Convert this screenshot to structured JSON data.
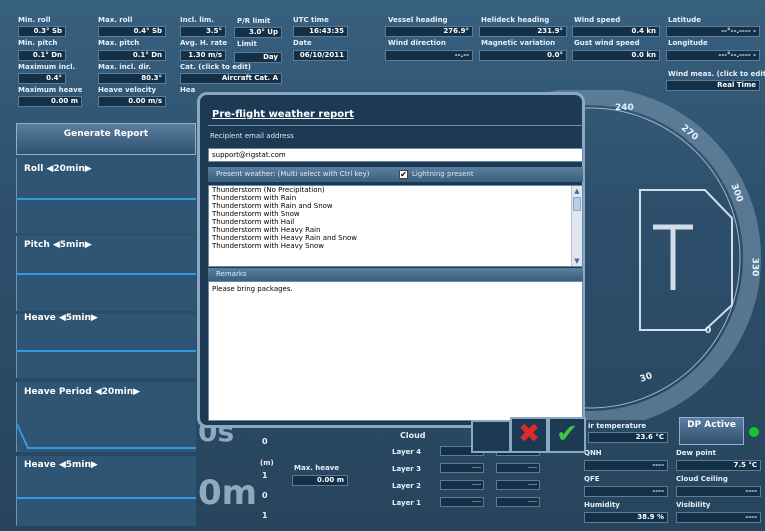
{
  "top_left": {
    "min_roll": {
      "label": "Min. roll",
      "value": "0.3° Sb"
    },
    "max_roll": {
      "label": "Max. roll",
      "value": "0.4° Sb"
    },
    "incl_lim": {
      "label": "Incl. lim.",
      "value": "3.5°"
    },
    "pr_limit": {
      "label": "P/R limit",
      "value": "3.0° Up"
    },
    "utc_time": {
      "label": "UTC time",
      "value": "16:43:35"
    },
    "min_pitch": {
      "label": "Min. pitch",
      "value": "0.1° Dn"
    },
    "max_pitch": {
      "label": "Max. pitch",
      "value": "0.1° Dn"
    },
    "avg_h_rate": {
      "label": "Avg. H. rate",
      "value": "1.30 m/s"
    },
    "limit": {
      "label": "Limit",
      "value": "Day"
    },
    "date": {
      "label": "Date",
      "value": "06/10/2011"
    },
    "max_incl": {
      "label": "Maximum incl.",
      "value": "0.4°"
    },
    "max_incl_dir": {
      "label": "Max. incl. dir.",
      "value": "80.3°"
    },
    "cat": {
      "label": "Cat. (click to edit)",
      "value": "Aircraft Cat. A"
    },
    "max_heave": {
      "label": "Maximum heave",
      "value": "0.00 m"
    },
    "heave_velocity": {
      "label": "Heave velocity",
      "value": "0.00 m/s"
    },
    "hea_cut": "Hea"
  },
  "top_right": {
    "vessel_heading": {
      "label": "Vessel heading",
      "value": "276.9°"
    },
    "helideck_heading": {
      "label": "Helideck heading",
      "value": "231.9°"
    },
    "wind_speed": {
      "label": "Wind speed",
      "value": "0.4 kn"
    },
    "latitude": {
      "label": "Latitude",
      "value": "--°--.---- -"
    },
    "wind_direction": {
      "label": "Wind direction",
      "value": "--.--"
    },
    "magnetic_variation": {
      "label": "Magnetic variation",
      "value": "0.0°"
    },
    "gust_wind_speed": {
      "label": "Gust wind speed",
      "value": "0.0 kn"
    },
    "longitude": {
      "label": "Longitude",
      "value": "---°--.---- -"
    },
    "wind_meas": {
      "label": "Wind meas. (click to edit)",
      "value": "Real Time"
    }
  },
  "left_panels": {
    "generate_report": "Generate Report",
    "roll": "Roll ◀20min▶",
    "pitch": "Pitch ◀5min▶",
    "heave": "Heave ◀5min▶",
    "heave_period": "Heave Period ◀20min▶",
    "heave2": "Heave ◀5min▶",
    "big_0s": "0s",
    "big_0m": "0m",
    "tick_0a": "0",
    "m_unit": "(m)",
    "tick_1a": "1",
    "tick_0b": "0",
    "tick_1b": "1",
    "max_heave_label": "Max. heave",
    "max_heave_value": "0.00 m"
  },
  "compass": {
    "t240": "240",
    "t270": "270",
    "t300": "300",
    "t330": "330",
    "t0": "0",
    "t30": "30"
  },
  "bottom_right": {
    "cloud": "Cloud",
    "layer4": "Layer 4",
    "layer3": "Layer 3",
    "layer2": "Layer 2",
    "layer1": "Layer 1",
    "dash": "----",
    "air_temp": {
      "label": "ir temperature",
      "value": "23.6 °C"
    },
    "qnh": {
      "label": "QNH",
      "value": "----"
    },
    "dew_point": {
      "label": "Dew point",
      "value": "7.5 °C"
    },
    "qfe": {
      "label": "QFE",
      "value": "----"
    },
    "cloud_ceiling": {
      "label": "Cloud Ceiling",
      "value": "----"
    },
    "humidity": {
      "label": "Humidity",
      "value": "38.9 %"
    },
    "visibility": {
      "label": "Visibility",
      "value": "----"
    },
    "dp_button": "DP Active"
  },
  "dialog": {
    "title": "Pre-flight weather report",
    "recipient_label": "Recipient email address",
    "email": "support@rigstat.com",
    "present_weather_label": "Present weather: (Multi select with Ctrl key)",
    "lightning_label": "Lightning present",
    "weather_options": [
      "Thunderstorm (No Precipitation)",
      "Thunderstorm with Rain",
      "Thunderstorm with Rain and Snow",
      "Thunderstorm with Snow",
      "Thunderstorm with Hail",
      "Thunderstorm with Heavy Rain",
      "Thunderstorm with Heavy Rain and Snow",
      "Thunderstorm with Heavy Snow"
    ],
    "remarks_label": "Remarks",
    "remarks_text": "Please bring packages."
  }
}
